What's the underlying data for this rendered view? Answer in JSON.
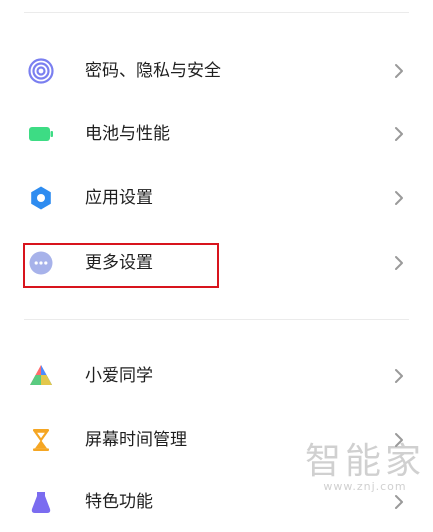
{
  "sections": [
    {
      "items": [
        {
          "label": "密码、隐私与安全",
          "icon": "fingerprint-icon",
          "color": "#7a7ff0"
        },
        {
          "label": "电池与性能",
          "icon": "battery-icon",
          "color": "#3ddc84"
        },
        {
          "label": "应用设置",
          "icon": "settings-gear-icon",
          "color": "#2e8cf0"
        },
        {
          "label": "更多设置",
          "icon": "more-dots-icon",
          "color": "#a7b2ea"
        }
      ]
    },
    {
      "items": [
        {
          "label": "小爱同学",
          "icon": "xiaoai-icon",
          "color": "#ff6b6b"
        },
        {
          "label": "屏幕时间管理",
          "icon": "hourglass-icon",
          "color": "#f5a623"
        },
        {
          "label": "特色功能",
          "icon": "feature-icon",
          "color": "#7b6cf0"
        }
      ]
    }
  ],
  "watermark": {
    "text": "智能家",
    "url": "www.znj.com"
  },
  "highlight_color": "#d8141d"
}
